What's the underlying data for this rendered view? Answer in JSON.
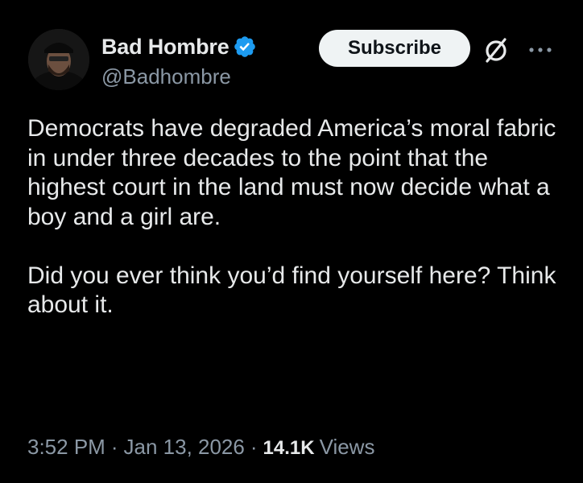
{
  "author": {
    "display_name": "Bad Hombre",
    "handle": "@Badhombre",
    "verified": true
  },
  "actions": {
    "subscribe_label": "Subscribe",
    "grok_icon": "slashed-circle-icon",
    "more_icon": "more-options-icon"
  },
  "post": {
    "text": "Democrats have degraded America’s moral fabric in under three decades to the point that the highest court in the land must now decide what a boy and a girl are.\n\nDid you ever think you’d find yourself here? Think about it.",
    "time": "3:52 PM",
    "date": "Jan 13, 2026",
    "separator": "·",
    "views_count": "14.1K",
    "views_label": "Views"
  },
  "colors": {
    "background": "#000000",
    "text": "#e7e9ea",
    "secondary": "#8b98a5",
    "verified": "#1d9bf0",
    "button_bg": "#eff3f4"
  }
}
